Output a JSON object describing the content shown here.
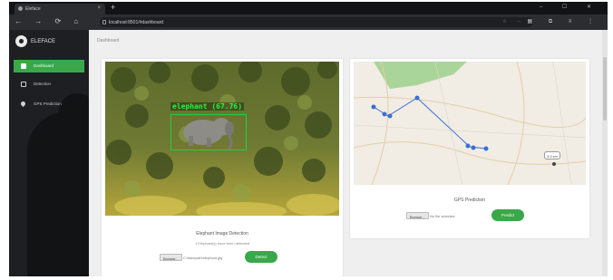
{
  "browser": {
    "tab_title": "Eleface",
    "tab_close": "×",
    "new_tab": "+",
    "window_controls": "– ☐ ✕",
    "nav_buttons": "← → ⟳ ⌂",
    "url": "localhost:8501/#dashboard",
    "url_actions": "☆ ⋯",
    "extensions": "▦ ⧉ ≡ ⋮"
  },
  "sidebar": {
    "brand": "ELEFACE",
    "items": [
      {
        "label": "Dashboard",
        "icon": "check-square-icon",
        "active": true
      },
      {
        "label": "Detection",
        "icon": "image-icon",
        "active": false
      },
      {
        "label": "GPS Prediction",
        "icon": "map-pin-icon",
        "active": false
      }
    ]
  },
  "main": {
    "breadcrumb": "Dashboard",
    "detection_card": {
      "detection_label": "elephant (67.76)",
      "title": "Elephant Image Detection",
      "subtitle": "1 Elephant(s) have been detected",
      "browse_label": "Browse...",
      "file_name": "C:\\fakepath\\elephant.jpg",
      "button_label": "Detect"
    },
    "gps_card": {
      "map_note": "3.5 km",
      "title": "GPS Prediction",
      "browse_label": "Browse...",
      "file_name": "No file selected.",
      "button_label": "Predict"
    }
  },
  "colors": {
    "accent": "#3aa84a",
    "sidebar": "#1d1f23",
    "detection_box": "#1fd23c",
    "route": "#3b6fd6"
  }
}
